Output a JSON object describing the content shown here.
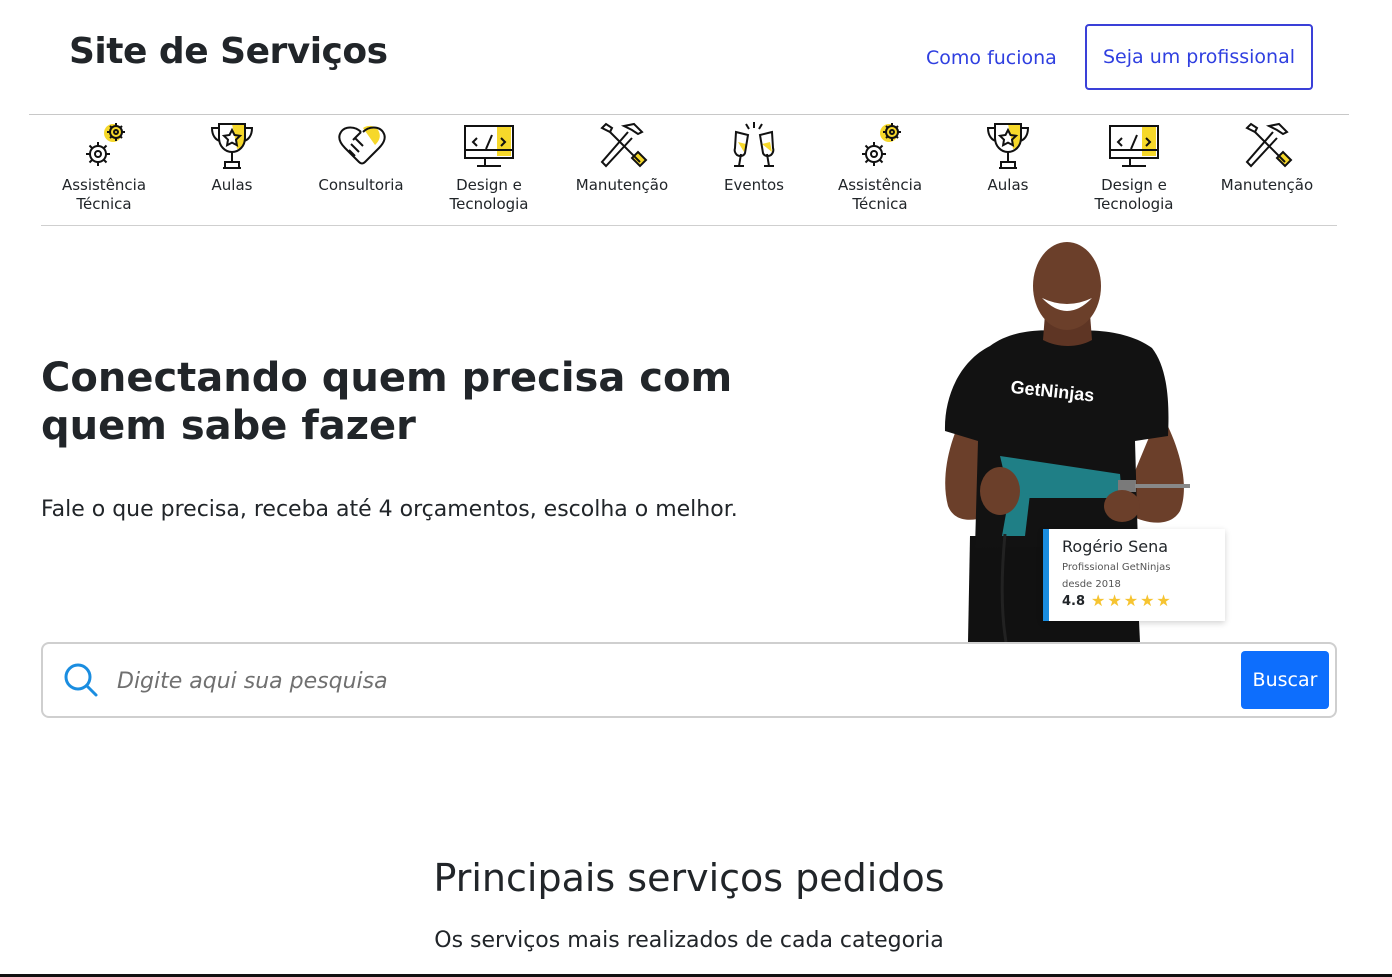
{
  "header": {
    "site_title": "Site de Serviços",
    "nav_link": "Como fuciona",
    "cta_button": "Seja um profissional"
  },
  "categories": [
    {
      "label": "Assistência Técnica",
      "icon": "gears-icon"
    },
    {
      "label": "Aulas",
      "icon": "trophy-icon"
    },
    {
      "label": "Consultoria",
      "icon": "handshake-icon"
    },
    {
      "label": "Design e Tecnologia",
      "icon": "code-monitor-icon"
    },
    {
      "label": "Manutenção",
      "icon": "tools-icon"
    },
    {
      "label": "Eventos",
      "icon": "champagne-icon"
    },
    {
      "label": "Assistência Técnica",
      "icon": "gears-icon"
    },
    {
      "label": "Aulas",
      "icon": "trophy-icon"
    },
    {
      "label": "Design e Tecnologia",
      "icon": "code-monitor-icon"
    },
    {
      "label": "Manutenção",
      "icon": "tools-icon"
    }
  ],
  "hero": {
    "title": "Conectando quem precisa com quem sabe fazer",
    "subtitle": "Fale o que precisa, receba até 4 orçamentos, escolha o melhor.",
    "shirt_text": "GetNinjas"
  },
  "pro_card": {
    "name": "Rogério Sena",
    "description": "Profissional GetNinjas desde 2018",
    "rating": "4.8",
    "stars": 5
  },
  "search": {
    "placeholder": "Digite aqui sua pesquisa",
    "button": "Buscar"
  },
  "section": {
    "title": "Principais serviços pedidos",
    "subtitle": "Os serviços mais realizados de cada categoria"
  },
  "colors": {
    "accent_blue": "#0d6efd",
    "link_blue": "#2f3fe0",
    "icon_yellow": "#f6d82a",
    "star_yellow": "#f6c431",
    "card_accent": "#1a8de0"
  }
}
